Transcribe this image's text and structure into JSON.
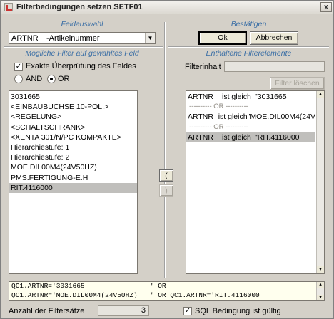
{
  "window": {
    "title": "Filterbedingungen setzen SETF01",
    "close_label": "x"
  },
  "feldauswahl": {
    "group_title": "Feldauswahl",
    "combo_field": "ARTNR",
    "combo_desc": "-Artikelnummer",
    "arrow_icon": "chevron-down-icon"
  },
  "bestaetigen": {
    "group_title": "Bestätigen",
    "ok_label": "Ok",
    "abbrechen_label": "Abbrechen"
  },
  "moegliche_filter": {
    "group_title": "Mögliche Filter auf gewähltes Feld",
    "exact_check_label": "Exakte Überprüfung des Feldes",
    "exact_checked": true,
    "and_label": "AND",
    "or_label": "OR",
    "selected_logic": "OR",
    "items": [
      "3031665",
      "<EINBAUBUCHSE 10-POL.>",
      "<REGELUNG>",
      "<SCHALTSCHRANK>",
      "<XENTA 301/N/PC KOMPAKTE>",
      "Hierarchiestufe:  1",
      "Hierarchiestufe:  2",
      "MOE.DIL00M4(24V50HZ)",
      "PMS.FERTIGUNG-E.H",
      "RIT.4116000"
    ],
    "selected_index": 9
  },
  "move_buttons": {
    "open_paren": "(",
    "close_paren": ")"
  },
  "enthaltene": {
    "group_title": "Enthaltene Filterelemente",
    "filterinhalt_label": "Filterinhalt",
    "filterinhalt_value": "",
    "filter_loeschen_label": "Filter löschen",
    "rows": [
      {
        "field": "ARTNR",
        "op": "ist gleich",
        "value": "\"3031665"
      },
      {
        "separator": "---------- OR ----------"
      },
      {
        "field": "ARTNR",
        "op": "ist gleich",
        "value": "\"MOE.DIL00M4(24V"
      },
      {
        "separator": "---------- OR ----------"
      },
      {
        "field": "ARTNR",
        "op": "ist gleich",
        "value": "\"RIT.4116000"
      }
    ],
    "selected_row": 4
  },
  "sql": {
    "lines": [
      "QC1.ARTNR='3031665                ' OR",
      "QC1.ARTNR='MOE.DIL00M4(24V50HZ)   ' OR QC1.ARTNR='RIT.4116000"
    ]
  },
  "footer": {
    "anzahl_label": "Anzahl der Filtersätze",
    "anzahl_value": "3",
    "sql_valid_label": "SQL Bedingung ist gültig",
    "sql_valid_checked": true
  }
}
